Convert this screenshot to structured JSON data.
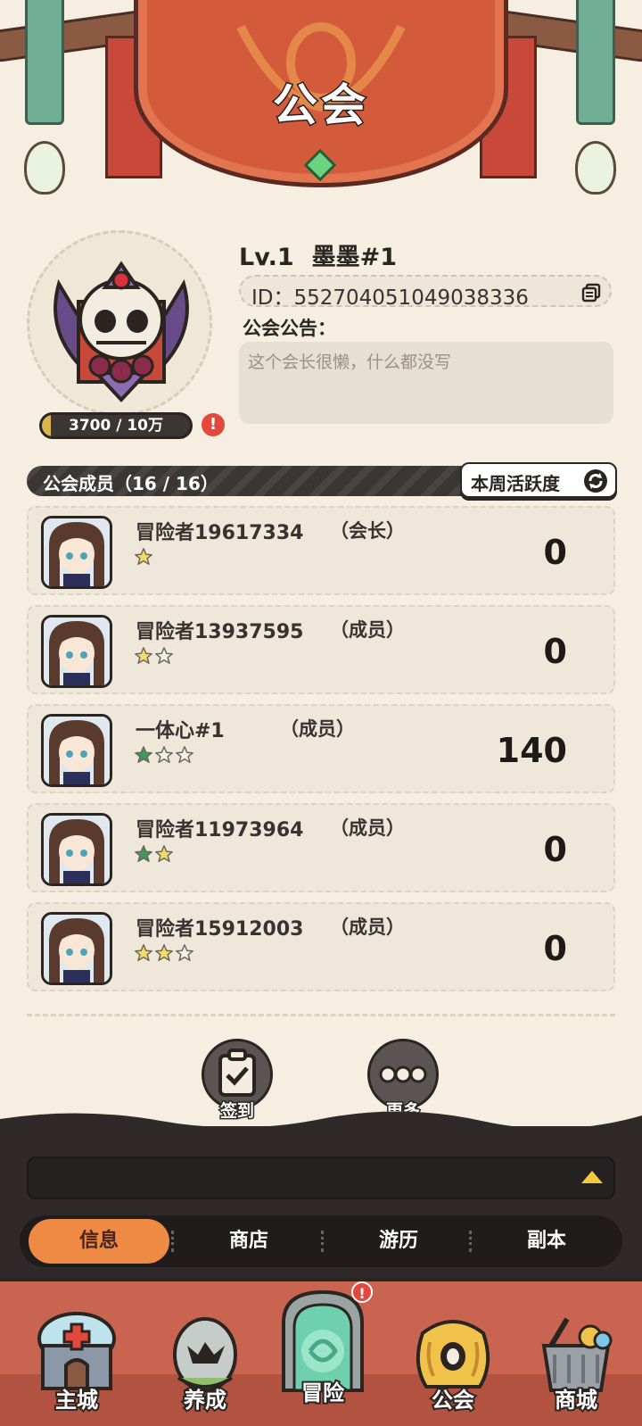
{
  "page": {
    "title": "公会"
  },
  "guild": {
    "level": "Lv.1",
    "name": "墨墨#1",
    "id_text": "ID：552704051049038336",
    "notice_label": "公会公告：",
    "notice_text": "这个会长很懒，什么都没写",
    "exp_text": "3700 / 10万",
    "exp_progress": 0.037,
    "exp_alert": "!"
  },
  "members": {
    "title": "公会成员（16 / 16）",
    "sort_label": "本周活跃度",
    "rows": [
      {
        "name": "冒险者19617334",
        "role": "（会长）",
        "score": "0",
        "stars": [
          "yellow"
        ]
      },
      {
        "name": "冒险者13937595",
        "role": "（成员）",
        "score": "0",
        "stars": [
          "yellow",
          "white"
        ]
      },
      {
        "name": "一体心#1",
        "role": "（成员）",
        "score": "140",
        "stars": [
          "green",
          "white",
          "white"
        ]
      },
      {
        "name": "冒险者11973964",
        "role": "（成员）",
        "score": "0",
        "stars": [
          "green",
          "yellow"
        ]
      },
      {
        "name": "冒险者15912003",
        "role": "（成员）",
        "score": "0",
        "stars": [
          "yellow",
          "yellow",
          "white"
        ]
      }
    ]
  },
  "actions": {
    "sign_in": "签到",
    "more": "更多"
  },
  "tabs": [
    "信息",
    "商店",
    "游历",
    "副本"
  ],
  "nav": [
    {
      "label": "主城",
      "icon": "castle-icon"
    },
    {
      "label": "养成",
      "icon": "egg-icon"
    },
    {
      "label": "冒险",
      "icon": "portal-icon",
      "alert": "!"
    },
    {
      "label": "公会",
      "icon": "guild-bag-icon"
    },
    {
      "label": "商城",
      "icon": "shop-basket-icon"
    }
  ],
  "colors": {
    "accent": "#ef8a45",
    "panel": "#2f2a29",
    "background": "#f6efe1",
    "banner": "#d45a3c"
  }
}
